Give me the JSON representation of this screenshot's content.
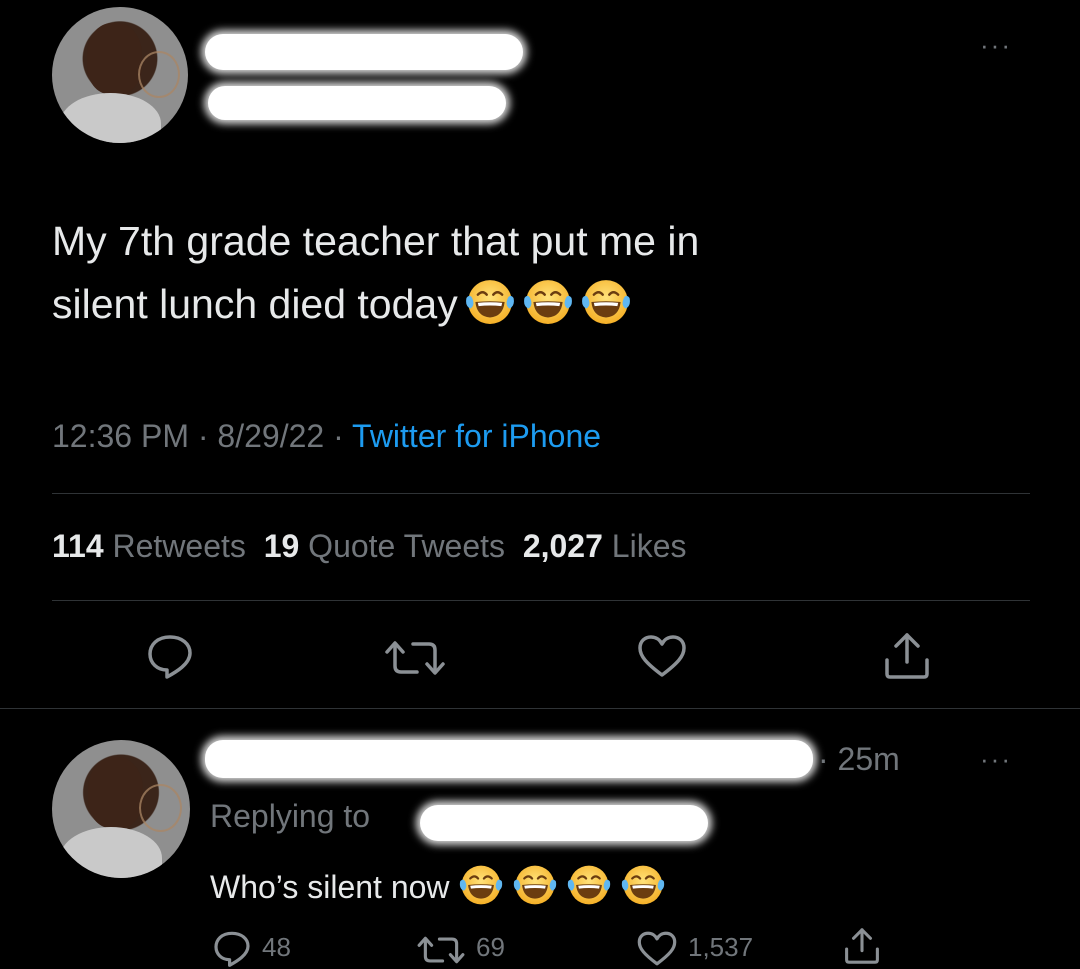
{
  "tweet": {
    "text_line1": "My 7th grade teacher that put me in",
    "text_line2": "silent lunch died today",
    "time": "12:36 PM",
    "date": "8/29/22",
    "sep": "·",
    "source": "Twitter for iPhone",
    "more_label": "···",
    "stats": {
      "retweets_count": "114",
      "retweets_label": "Retweets",
      "quotes_count": "19",
      "quotes_label": "Quote Tweets",
      "likes_count": "2,027",
      "likes_label": "Likes"
    },
    "emoji_name": "face-with-tears-of-joy"
  },
  "reply": {
    "time_ago": "· 25m",
    "replying_to_label": "Replying to",
    "text": "Who’s silent now",
    "more_label": "···",
    "counts": {
      "replies": "48",
      "retweets": "69",
      "likes": "1,537"
    }
  },
  "colors": {
    "background": "#000000",
    "text": "#e7e9ea",
    "muted": "#71767b",
    "link": "#1d9bf0",
    "divider": "#2f3336"
  }
}
